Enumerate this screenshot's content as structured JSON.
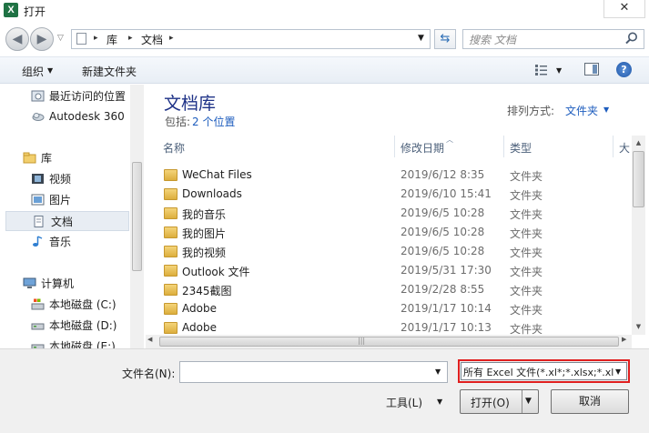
{
  "window": {
    "title": "打开",
    "app_icon_letter": "X",
    "close_glyph": "✕"
  },
  "nav": {
    "back_glyph": "◀",
    "forward_glyph": "▶",
    "history_glyph": "▽",
    "breadcrumb": [
      "库",
      "文档"
    ],
    "crumb_sep": "▸",
    "address_dropdown_glyph": "▼",
    "refresh_glyph": "⇆",
    "search_placeholder": "搜索 文档"
  },
  "toolbar": {
    "organize_label": "组织",
    "dropdown_glyph": "▼",
    "new_folder_label": "新建文件夹",
    "help_glyph": "?"
  },
  "sidebar": {
    "items": [
      {
        "label": "最近访问的位置",
        "icon": "recent-places-icon"
      },
      {
        "label": "Autodesk 360",
        "icon": "cloud-icon"
      },
      {
        "label": "库",
        "icon": "library-icon"
      },
      {
        "label": "视频",
        "icon": "video-icon"
      },
      {
        "label": "图片",
        "icon": "picture-icon"
      },
      {
        "label": "文档",
        "icon": "document-icon",
        "selected": true
      },
      {
        "label": "音乐",
        "icon": "music-icon"
      },
      {
        "label": "计算机",
        "icon": "computer-icon"
      },
      {
        "label": "本地磁盘 (C:)",
        "icon": "system-drive-icon"
      },
      {
        "label": "本地磁盘 (D:)",
        "icon": "drive-icon"
      },
      {
        "label": "本地磁盘 (E:)",
        "icon": "drive-icon"
      }
    ]
  },
  "library": {
    "title": "文档库",
    "includes_label": "包括:",
    "includes_link": "2 个位置",
    "arrange_label": "排列方式:",
    "arrange_value": "文件夹"
  },
  "columns": {
    "name": "名称",
    "modified": "修改日期",
    "type": "类型",
    "size": "大"
  },
  "files": [
    {
      "name": "WeChat Files",
      "modified": "2019/6/12 8:35",
      "type": "文件夹"
    },
    {
      "name": "Downloads",
      "modified": "2019/6/10 15:41",
      "type": "文件夹"
    },
    {
      "name": "我的音乐",
      "modified": "2019/6/5 10:28",
      "type": "文件夹"
    },
    {
      "name": "我的图片",
      "modified": "2019/6/5 10:28",
      "type": "文件夹"
    },
    {
      "name": "我的视频",
      "modified": "2019/6/5 10:28",
      "type": "文件夹"
    },
    {
      "name": "Outlook 文件",
      "modified": "2019/5/31 17:30",
      "type": "文件夹"
    },
    {
      "name": "2345截图",
      "modified": "2019/2/28 8:55",
      "type": "文件夹"
    },
    {
      "name": "Adobe",
      "modified": "2019/1/17 10:14",
      "type": "文件夹"
    },
    {
      "name": "Adobe",
      "modified": "2019/1/17 10:13",
      "type": "文件夹"
    }
  ],
  "bottom": {
    "filename_label": "文件名(N):",
    "filename_value": "",
    "filetype_value": "所有 Excel 文件(*.xl*;*.xlsx;*.xl",
    "tools_label": "工具(L)",
    "open_label": "打开(O)",
    "cancel_label": "取消",
    "highlight_color": "#e01f1f"
  }
}
